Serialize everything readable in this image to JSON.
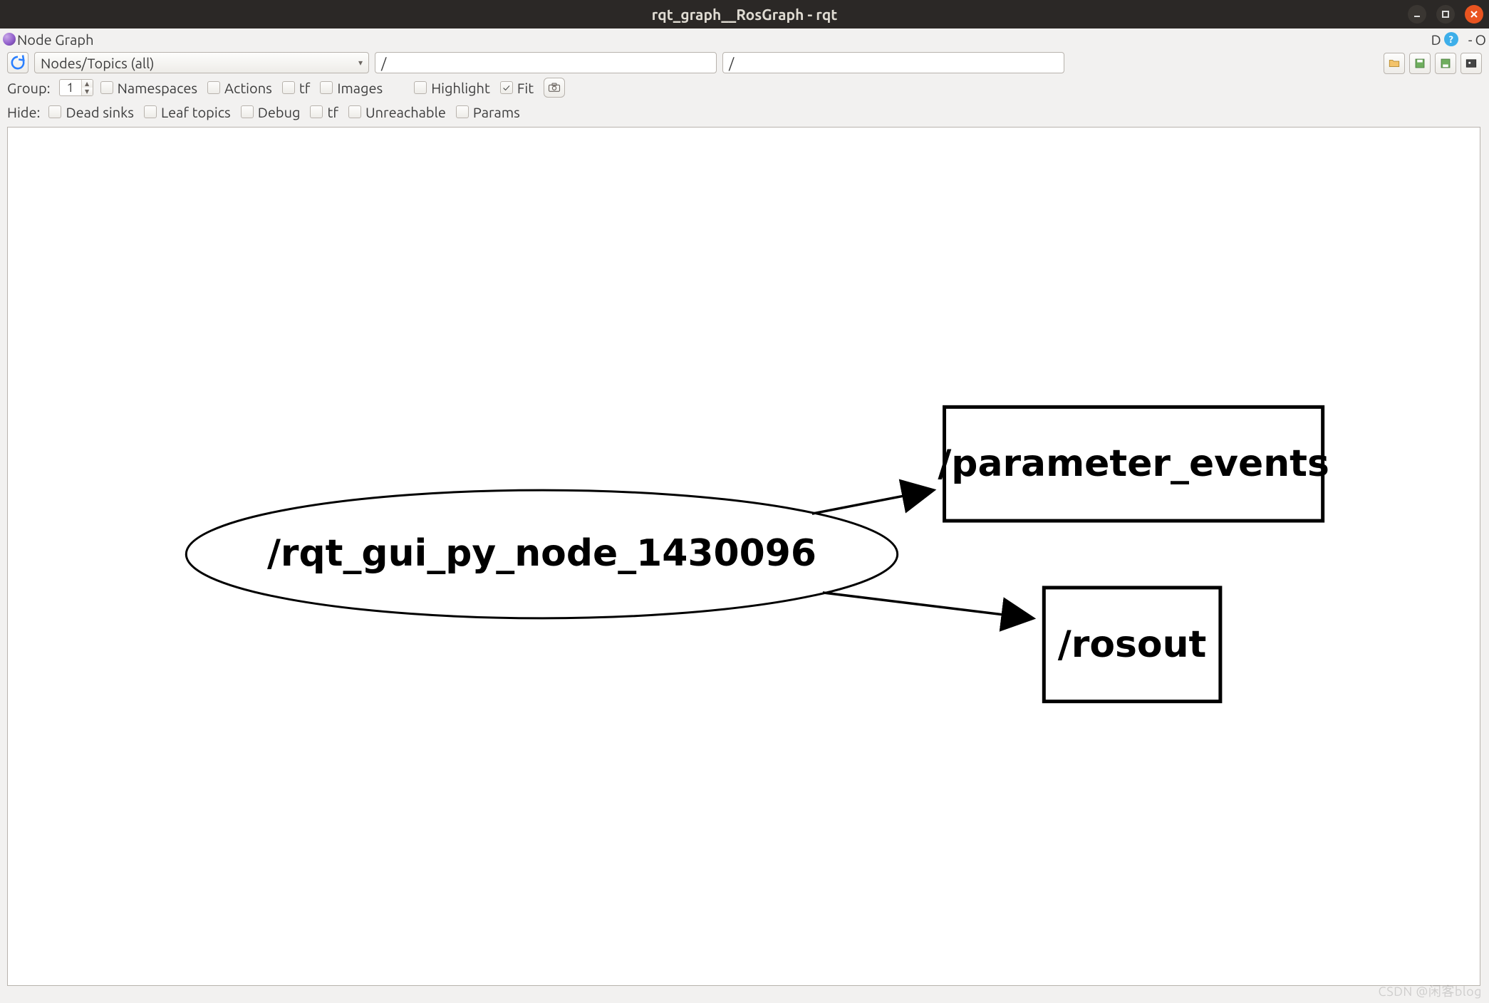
{
  "window": {
    "title": "rqt_graph__RosGraph - rqt"
  },
  "plugin_header": {
    "title": "Node Graph",
    "right": {
      "d": "D",
      "q": "?",
      "dash": "-",
      "o": "O"
    }
  },
  "toolbar": {
    "dropdown": "Nodes/Topics (all)",
    "filter1": "/",
    "filter2": "/"
  },
  "group_row": {
    "label": "Group:",
    "value": "1",
    "namespaces": {
      "label": "Namespaces",
      "checked": false
    },
    "actions": {
      "label": "Actions",
      "checked": false
    },
    "tf": {
      "label": "tf",
      "checked": false
    },
    "images": {
      "label": "Images",
      "checked": false
    },
    "highlight": {
      "label": "Highlight",
      "checked": false
    },
    "fit": {
      "label": "Fit",
      "checked": true
    }
  },
  "hide_row": {
    "label": "Hide:",
    "dead_sinks": {
      "label": "Dead sinks",
      "checked": false
    },
    "leaf_topics": {
      "label": "Leaf topics",
      "checked": false
    },
    "debug": {
      "label": "Debug",
      "checked": false
    },
    "tf": {
      "label": "tf",
      "checked": false
    },
    "unreachable": {
      "label": "Unreachable",
      "checked": false
    },
    "params": {
      "label": "Params",
      "checked": false
    }
  },
  "graph": {
    "nodes": [
      {
        "id": "n0",
        "type": "ellipse",
        "label": "/rqt_gui_py_node_1430096"
      },
      {
        "id": "n1",
        "type": "rect",
        "label": "/parameter_events"
      },
      {
        "id": "n2",
        "type": "rect",
        "label": "/rosout"
      }
    ],
    "edges": [
      {
        "from": "n0",
        "to": "n1"
      },
      {
        "from": "n0",
        "to": "n2"
      }
    ]
  },
  "watermark": "CSDN @闲客blog"
}
